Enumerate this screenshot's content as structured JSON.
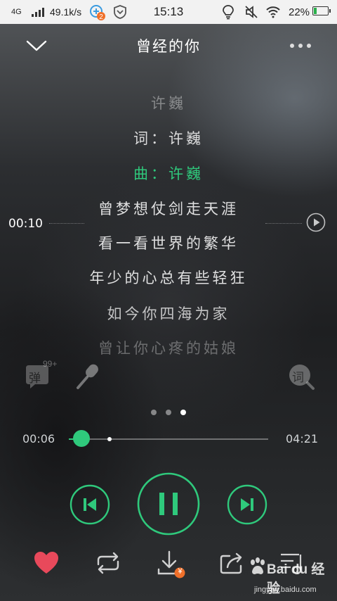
{
  "status_bar": {
    "network": "4G",
    "speed": "49.1k/s",
    "app_badge": "2",
    "time": "15:13",
    "battery": "22%",
    "battery_level": 0.22,
    "icons": [
      "signal-icon",
      "app-update-icon",
      "shield-app-icon",
      "bulb-icon",
      "mute-icon",
      "wifi-icon",
      "battery-icon"
    ]
  },
  "header": {
    "title": "曾经的你",
    "collapse_icon": "chevron-down-icon",
    "more_icon": "more-dots-icon"
  },
  "lyrics": {
    "lines": [
      {
        "text": "许巍",
        "state": "dim"
      },
      {
        "text": "词：许巍",
        "state": "normal"
      },
      {
        "text": "曲：许巍",
        "state": "current"
      },
      {
        "text": "曾梦想仗剑走天涯",
        "state": "normal"
      },
      {
        "text": "看一看世界的繁华",
        "state": "normal"
      },
      {
        "text": "年少的心总有些轻狂",
        "state": "normal"
      },
      {
        "text": "如今你四海为家",
        "state": "normal"
      },
      {
        "text": "曾让你心疼的姑娘",
        "state": "fade"
      }
    ],
    "seek_time": "00:10"
  },
  "tools": {
    "danmaku_label": "弹",
    "danmaku_count": "99+",
    "lyric_search_label": "词"
  },
  "pager": {
    "count": 3,
    "active": 3
  },
  "progress": {
    "elapsed": "00:06",
    "total": "04:21",
    "fraction": 0.023,
    "buffered_fraction": 0.2
  },
  "controls": {
    "prev_icon": "previous-track-icon",
    "pause_icon": "pause-icon",
    "next_icon": "next-track-icon"
  },
  "bottom_bar": {
    "icons": [
      "heart-icon",
      "repeat-icon",
      "download-icon",
      "share-icon",
      "playlist-icon"
    ],
    "download_badge": "¥"
  },
  "watermark": {
    "brand": "Bai du 经验",
    "url": "jingyan.baidu.com"
  },
  "colors": {
    "accent": "#2fc97c",
    "heart": "#e8495b",
    "badge": "#f0702a"
  }
}
